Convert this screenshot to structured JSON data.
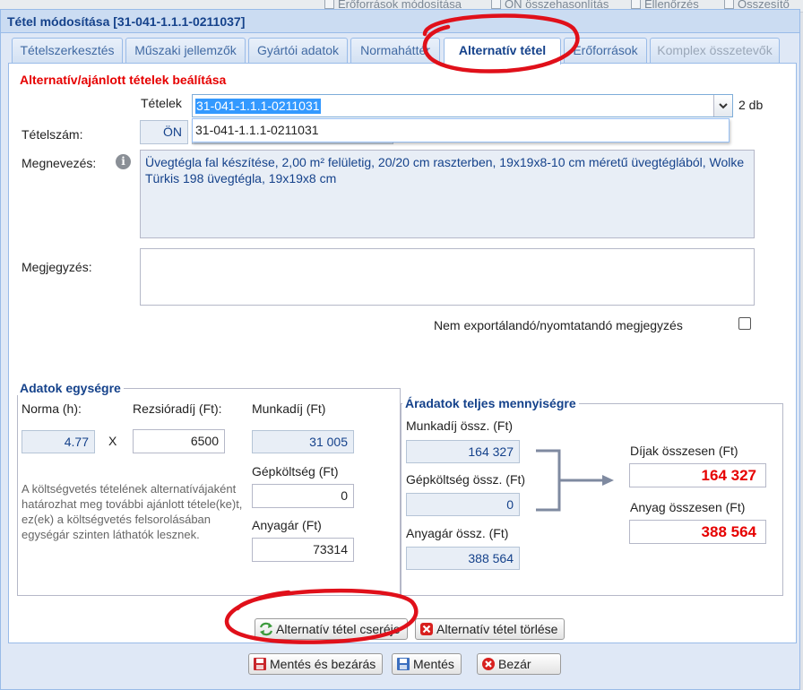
{
  "background": {
    "toolbar_items": [
      "Erőforrások módosítása",
      "ÖN összehasonlítás",
      "Ellenőrzés",
      "Összesítő"
    ]
  },
  "dialog": {
    "title": "Tétel módosítása [31-041-1.1.1-0211037]",
    "tabs": [
      {
        "label": "Tételszerkesztés",
        "state": "normal"
      },
      {
        "label": "Műszaki jellemzők",
        "state": "normal"
      },
      {
        "label": "Gyártói adatok",
        "state": "normal"
      },
      {
        "label": "Normaháttér",
        "state": "normal"
      },
      {
        "label": "Alternatív tétel",
        "state": "active"
      },
      {
        "label": "Erőforrások",
        "state": "normal"
      },
      {
        "label": "Komplex összetevők",
        "state": "disabled"
      }
    ]
  },
  "alt": {
    "section_title": "Alternatív/ajánlott tételek beálítása",
    "tetelek_label": "Tételek",
    "tetelek_value": "31-041-1.1.1-0211031",
    "count": "2 db",
    "dropdown_option": "31-041-1.1.1-0211031",
    "tetelszam_label": "Tételszám:",
    "tetelszam_prefix": "ÖN",
    "megnevezes_label": "Megnevezés:",
    "megnevezes_value": "Üvegtégla fal készítése, 2,00 m² felületig, 20/20 cm raszterben, 19x19x8-10 cm méretű üvegtéglából, Wolke Türkis 198 üvegtégla, 19x19x8 cm",
    "megjegyzes_label": "Megjegyzés:",
    "megjegyzes_value": "",
    "nem_export_label": "Nem exportálandó/nyomtatandó megjegyzés",
    "nem_export_checked": false
  },
  "unit_data": {
    "legend": "Adatok egységre",
    "norma_label": "Norma (h):",
    "norma_value": "4.77",
    "x_sign": "X",
    "rezsi_label": "Rezsióradíj (Ft):",
    "rezsi_value": "6500",
    "munkadij_label": "Munkadíj (Ft)",
    "munkadij_value": "31 005",
    "gepkoltseg_label": "Gépköltség (Ft)",
    "gepkoltseg_value": "0",
    "anyagar_label": "Anyagár (Ft)",
    "anyagar_value": "73314",
    "note": "A költségvetés tételének alternatívájaként határozhat meg további ajánlott tétele(ke)t, ez(ek) a költségvetés felsorolásában egységár szinten láthatók lesznek."
  },
  "total_data": {
    "legend": "Áradatok teljes mennyiségre",
    "munkadij_ossz_label": "Munkadíj össz. (Ft)",
    "munkadij_ossz_value": "164 327",
    "gepkoltseg_ossz_label": "Gépköltség össz. (Ft)",
    "gepkoltseg_ossz_value": "0",
    "anyagar_ossz_label": "Anyagár össz. (Ft)",
    "anyagar_ossz_value": "388 564",
    "dijak_label": "Díjak összesen (Ft)",
    "dijak_value": "164 327",
    "anyag_label": "Anyag összesen (Ft)",
    "anyag_value": "388 564"
  },
  "buttons": {
    "replace_label": "Alternatív tétel cseréje",
    "delete_label": "Alternatív tétel törlése",
    "save_close_label": "Mentés és bezárás",
    "save_label": "Mentés",
    "close_label": "Bezár"
  },
  "colors": {
    "accent_blue": "#15428b",
    "section_red": "#e60000",
    "annotation_red": "#e0101a",
    "panel_border": "#99bbe8"
  }
}
